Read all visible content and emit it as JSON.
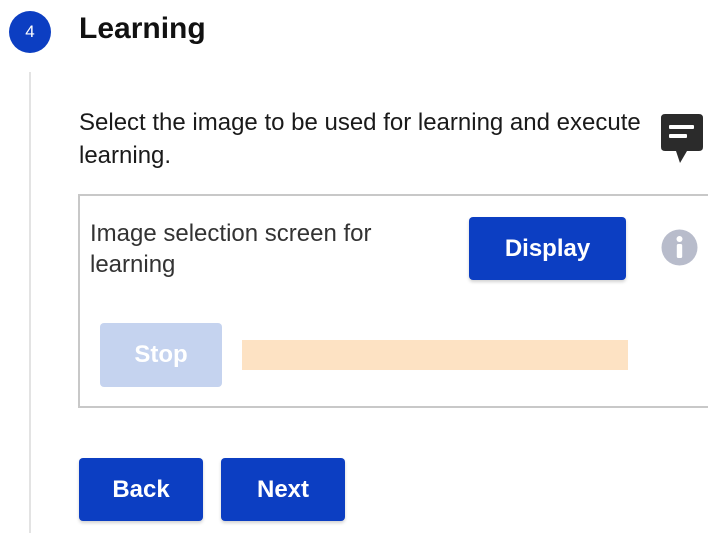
{
  "step": {
    "number": "4",
    "title": "Learning"
  },
  "instruction": "Select the image to be used for learning and execute learning.",
  "panel": {
    "label": "Image selection screen for learning",
    "display_button": "Display",
    "stop_button": "Stop",
    "progress_percent": 0
  },
  "footer": {
    "back_button": "Back",
    "next_button": "Next"
  },
  "icons": {
    "comment": "comment-icon",
    "info": "info-icon"
  },
  "colors": {
    "primary": "#0c3ec2",
    "disabled_button": "#c5d3ef",
    "progress_track": "#fde2c3",
    "info_icon": "#b8bccb",
    "comment_icon": "#2b2b2b"
  }
}
